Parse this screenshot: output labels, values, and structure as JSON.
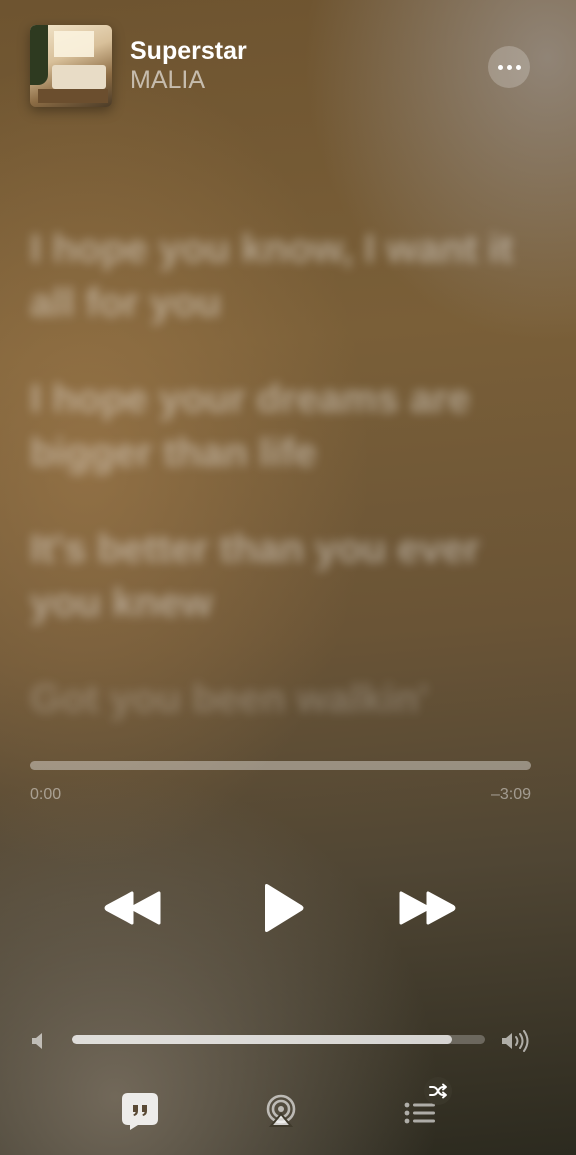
{
  "now_playing": {
    "title": "Superstar",
    "artist": "MALIA"
  },
  "lyrics": [
    "I hope you know, I want it all for you",
    "I hope your dreams are bigger than life",
    "It's better than you ever you knew",
    "Got you been walkin'"
  ],
  "playback": {
    "elapsed": "0:00",
    "remaining": "–3:09",
    "progress": 0.0,
    "volume": 0.92
  },
  "icons": {
    "more": "ellipsis-icon",
    "rewind": "rewind-icon",
    "play": "play-icon",
    "forward": "fast-forward-icon",
    "volume_low": "speaker-low-icon",
    "volume_high": "speaker-high-icon",
    "lyrics": "quote-bubble-icon",
    "airplay": "airplay-icon",
    "queue": "queue-list-icon",
    "shuffle": "shuffle-icon"
  }
}
